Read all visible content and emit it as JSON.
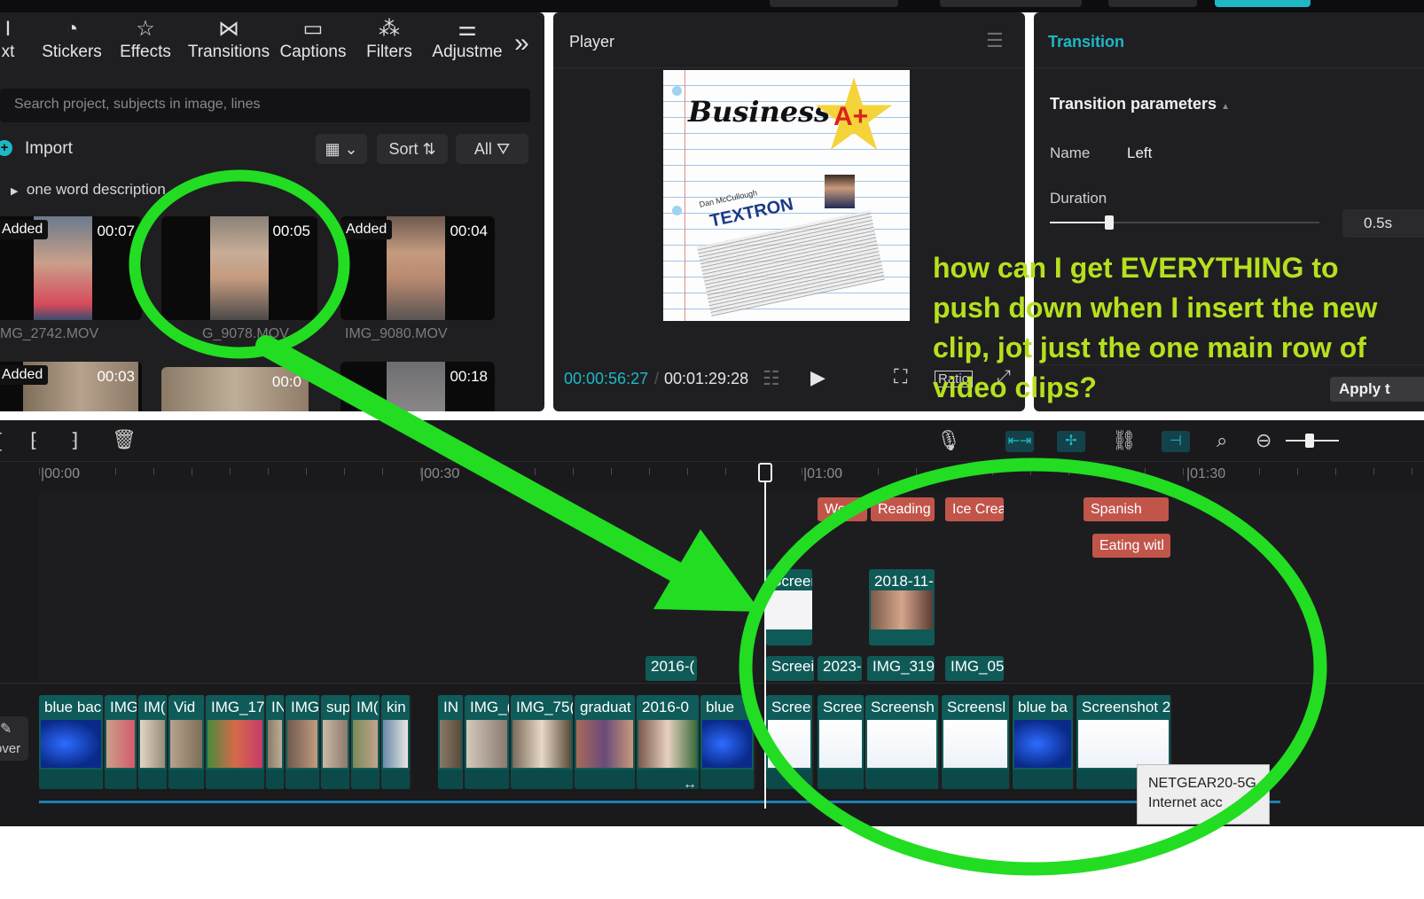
{
  "toolbar": {
    "tabs": [
      {
        "label": "xt",
        "icon": "text-icon"
      },
      {
        "label": "Stickers",
        "icon": "sticker-icon"
      },
      {
        "label": "Effects",
        "icon": "effects-star-icon"
      },
      {
        "label": "Transitions",
        "icon": "transition-bowtie-icon"
      },
      {
        "label": "Captions",
        "icon": "captions-icon"
      },
      {
        "label": "Filters",
        "icon": "filters-icon"
      },
      {
        "label": "Adjustme",
        "icon": "adjust-sliders-icon"
      }
    ],
    "more_icon": "»"
  },
  "media": {
    "search_placeholder": "Search project, subjects in image, lines",
    "import_label": "Import",
    "sort_label": "Sort",
    "filter_label": "All",
    "folder_label": "one word description",
    "items": [
      {
        "duration": "00:07",
        "added": "Added",
        "name": "MG_2742.MOV"
      },
      {
        "duration": "00:05",
        "added": "",
        "name": "G_9078.MOV"
      },
      {
        "duration": "00:04",
        "added": "Added",
        "name": "IMG_9080.MOV"
      },
      {
        "duration": "00:03",
        "added": "Added",
        "name": ""
      },
      {
        "duration": "00:0",
        "added": "",
        "name": ""
      },
      {
        "duration": "00:18",
        "added": "",
        "name": ""
      }
    ]
  },
  "player": {
    "title": "Player",
    "current_time": "00:00:56:27",
    "total_time": "00:01:29:28",
    "ratio_label": "Ratio",
    "preview": {
      "heading": "Business",
      "grade": "A+",
      "name": "Dan McCullough",
      "company": "TEXTRON"
    }
  },
  "transition": {
    "tab": "Transition",
    "params_heading": "Transition parameters",
    "name_label": "Name",
    "name_value": "Left",
    "duration_label": "Duration",
    "duration_value": "0.5s",
    "duration_fraction": 0.22,
    "apply_label": "Apply t"
  },
  "timeline": {
    "ruler": [
      "00:00",
      "00:30",
      "01:00",
      "01:30"
    ],
    "cover_label": "over",
    "text_clips": [
      "Wo",
      "Reading",
      "Ice Crea",
      "Spanish",
      "Eating witl"
    ],
    "overlay_clips": [
      "Screen TEXTR",
      "2018-11-",
      "2016-(",
      "Screei",
      "2023-",
      "IMG_319",
      "IMG_05"
    ],
    "main_clips": [
      "blue bac",
      "IMG",
      "IM(",
      "Vid",
      "IMG_17",
      "IN",
      "IMG",
      "sup",
      "IM(",
      "kin",
      "IN",
      "IMG_(",
      "IMG_75(",
      "graduat",
      "2016-0",
      "blue",
      "Scree",
      "Scree",
      "Screensh",
      "Screensl",
      "blue ba",
      "Screenshot 2"
    ]
  },
  "tooltip": {
    "line1": "NETGEAR20-5G",
    "line2": "Internet acc"
  },
  "annotation": {
    "text": "how can I get EVERYTHING to push down when I insert the new clip, jot just the one main row of video clips?",
    "color": "#b6e01e",
    "overlay_color": "#22dd22"
  },
  "colors": {
    "accent": "#1fb7c4",
    "text_clip": "#c2554a",
    "video_clip": "#0f5a57",
    "background": "#1f1f22"
  }
}
